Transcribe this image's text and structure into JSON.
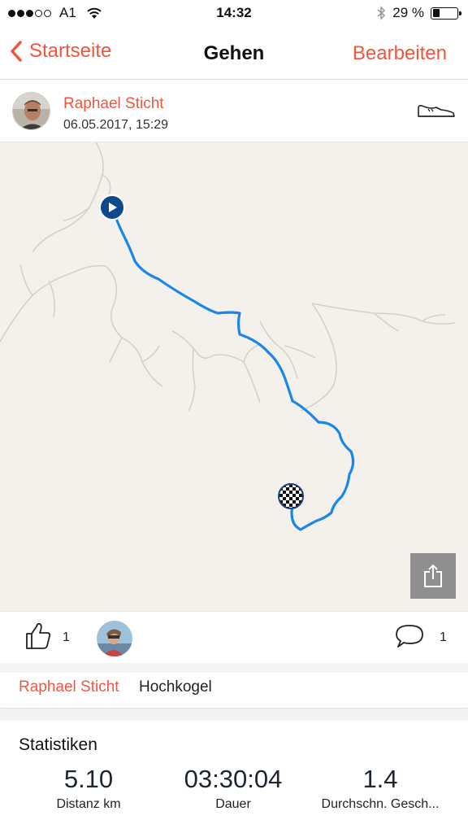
{
  "status_bar": {
    "carrier": "A1",
    "time": "14:32",
    "battery_text": "29 %",
    "battery_level": 0.29,
    "signal_bars_filled": 3,
    "signal_bars_total": 5
  },
  "nav": {
    "back_label": "Startseite",
    "title": "Gehen",
    "edit_label": "Bearbeiten"
  },
  "activity": {
    "author": "Raphael Sticht",
    "date": "06.05.2017, 15:29",
    "type_icon": "shoe-icon"
  },
  "social": {
    "likes": "1",
    "comments": "1"
  },
  "title_row": {
    "author": "Raphael Sticht",
    "title": "Hochkogel"
  },
  "stats": {
    "heading": "Statistiken",
    "items": [
      {
        "value": "5.10",
        "label": "Distanz km"
      },
      {
        "value": "03:30:04",
        "label": "Dauer"
      },
      {
        "value": "1.4",
        "label": "Durchschn. Gesch..."
      }
    ]
  },
  "colors": {
    "accent": "#f2553d",
    "route": "#1a86e8",
    "start_marker": "#0d4a8c",
    "map_background": "#f4f1ec"
  }
}
